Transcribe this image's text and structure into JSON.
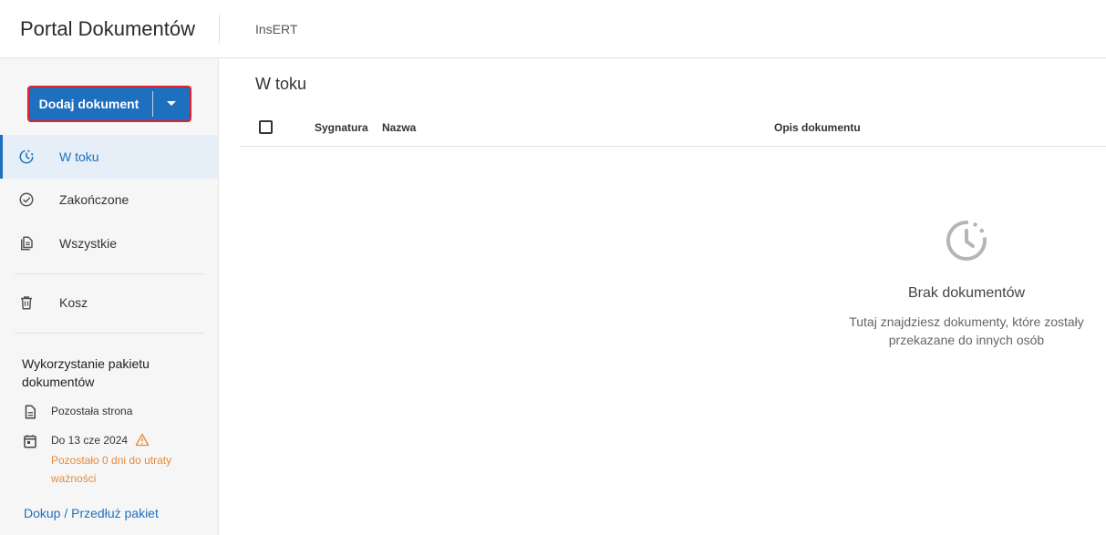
{
  "header": {
    "app_title": "Portal Dokumentów",
    "org_name": "InsERT"
  },
  "sidebar": {
    "add_button_label": "Dodaj dokument",
    "items": [
      {
        "label": "W toku",
        "icon": "clock-icon",
        "active": true
      },
      {
        "label": "Zakończone",
        "icon": "check-circle-icon",
        "active": false
      },
      {
        "label": "Wszystkie",
        "icon": "documents-icon",
        "active": false
      },
      {
        "label": "Kosz",
        "icon": "trash-icon",
        "active": false
      }
    ],
    "usage": {
      "title": "Wykorzystanie pakietu dokumentów",
      "pages_left": "Pozostała strona",
      "valid_until": "Do 13 cze 2024",
      "expiry_warning": "Pozostało 0 dni do utraty ważności",
      "renew_link": "Dokup / Przedłuż pakiet"
    }
  },
  "main": {
    "section_title": "W toku",
    "columns": [
      "Sygnatura",
      "Nazwa",
      "Opis dokumentu"
    ],
    "empty_state": {
      "title": "Brak dokumentów",
      "description": "Tutaj znajdziesz dokumenty, które zostały przekazane do innych osób"
    }
  },
  "colors": {
    "accent": "#1f6fbf",
    "warning": "#e8893c",
    "highlight_border": "#e0202a"
  }
}
